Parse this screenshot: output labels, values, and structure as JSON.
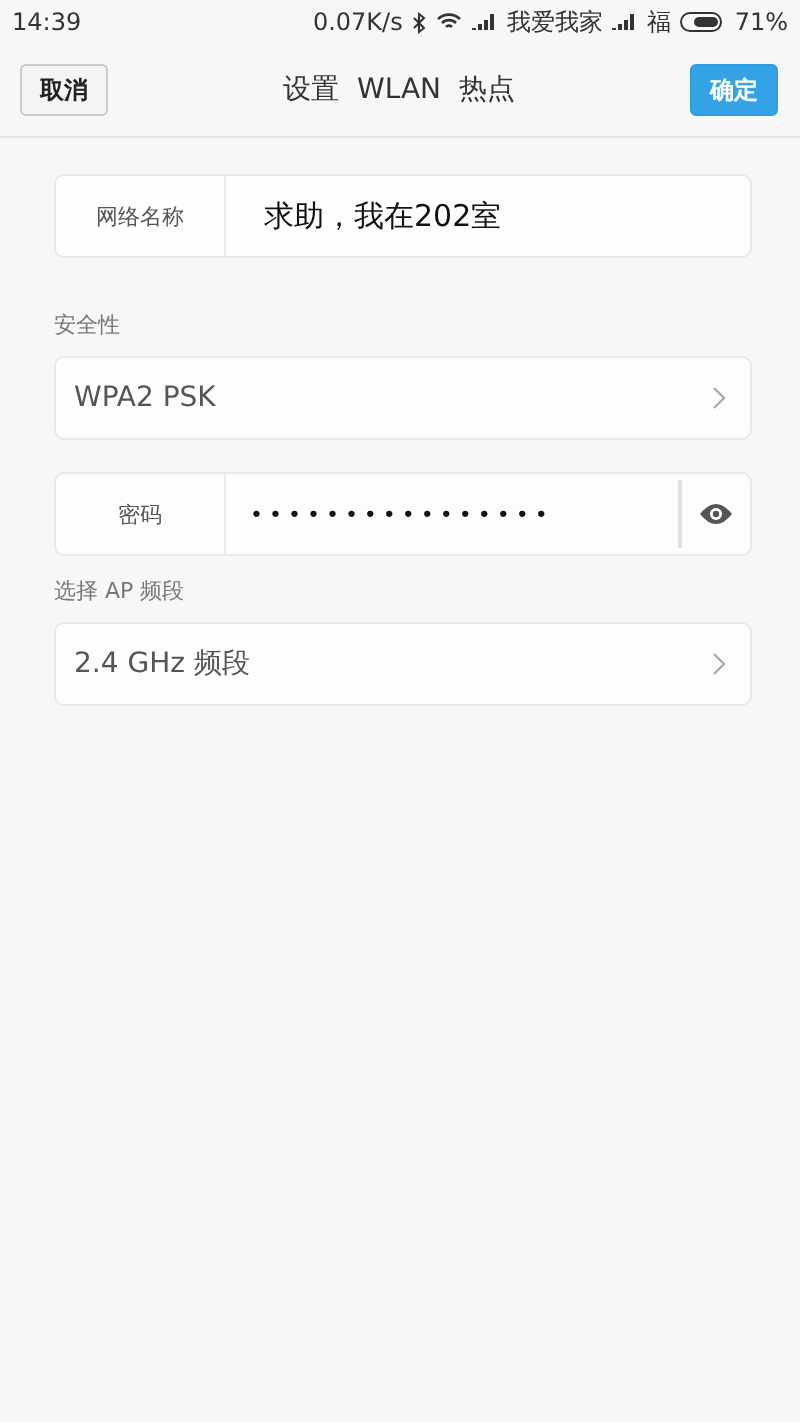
{
  "status_bar": {
    "time": "14:39",
    "speed": "0.07K/s",
    "carrier_1": "我爱我家",
    "carrier_2": "福",
    "battery": "71%"
  },
  "header": {
    "cancel": "取消",
    "title": "设置  WLAN  热点",
    "confirm": "确定"
  },
  "network_name": {
    "label": "网络名称",
    "value": "求助，我在202室"
  },
  "security": {
    "heading": "安全性",
    "value": "WPA2 PSK"
  },
  "password": {
    "label": "密码",
    "value": "••••••••••••••••"
  },
  "band": {
    "heading": "选择 AP 频段",
    "value": "2.4 GHz 频段"
  }
}
